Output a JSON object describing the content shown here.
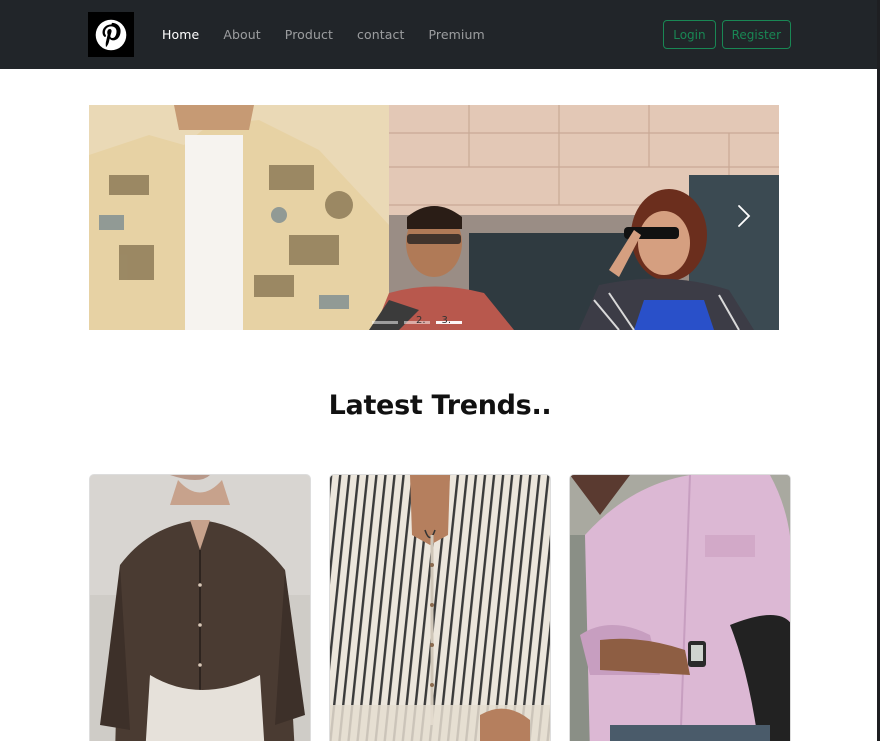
{
  "navbar": {
    "brand_icon": "pinterest-logo-icon",
    "links": [
      {
        "label": "Home",
        "active": true
      },
      {
        "label": "About",
        "active": false
      },
      {
        "label": "Product",
        "active": false
      },
      {
        "label": "contact",
        "active": false
      },
      {
        "label": "Premium",
        "active": false
      }
    ],
    "login_label": "Login",
    "register_label": "Register"
  },
  "carousel": {
    "indicator_labels": [
      "2.",
      "3."
    ],
    "active_slide": 1,
    "slide_count": 3,
    "next_icon": "chevron-right-icon"
  },
  "section": {
    "title": "Latest Trends.."
  },
  "cards": [
    {
      "description": "brown shirt"
    },
    {
      "description": "striped shirt"
    },
    {
      "description": "pink shirt"
    }
  ],
  "colors": {
    "navbar_bg": "#212529",
    "accent": "#198754"
  }
}
